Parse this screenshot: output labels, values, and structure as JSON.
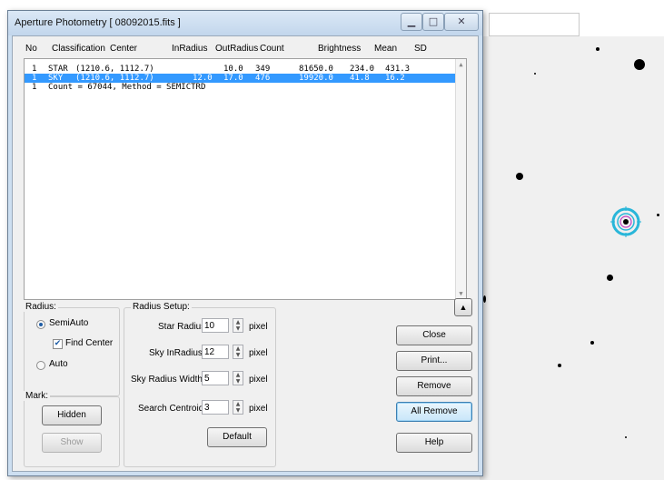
{
  "window": {
    "title": "Aperture Photometry [ 08092015.fits ]",
    "minimize_icon": "minimize-icon",
    "maximize_icon": "maximize-icon",
    "close_icon": "close-icon"
  },
  "table": {
    "columns": [
      "No",
      "Classification",
      "Center",
      "InRadius",
      "OutRadius",
      "Count",
      "Brightness",
      "Mean",
      "SD"
    ],
    "rows": [
      {
        "no": "1",
        "classification": "STAR",
        "center": "(1210.6, 1112.7)",
        "inradius": "",
        "outradius": "10.0",
        "count": "349",
        "brightness": "81650.0",
        "mean": "234.0",
        "sd": "431.3",
        "selected": false
      },
      {
        "no": "1",
        "classification": "SKY",
        "center": "(1210.6, 1112.7)",
        "inradius": "12.0",
        "outradius": "17.0",
        "count": "476",
        "brightness": "19920.0",
        "mean": "41.8",
        "sd": "16.2",
        "selected": true
      },
      {
        "no": "1",
        "summary": "Count = 67044, Method = SEMICTRD",
        "selected": false
      }
    ]
  },
  "radius_group": {
    "label": "Radius:",
    "semiauto_label": "SemiAuto",
    "semiauto_selected": true,
    "find_center_label": "Find Center",
    "find_center_checked": true,
    "auto_label": "Auto",
    "auto_selected": false
  },
  "mark_group": {
    "label": "Mark:",
    "hidden_label": "Hidden",
    "show_label": "Show"
  },
  "radius_setup": {
    "label": "Radius Setup:",
    "star_radius_label": "Star Radius:",
    "star_radius_value": "10",
    "sky_inradius_label": "Sky InRadius:",
    "sky_inradius_value": "12",
    "sky_width_label": "Sky Radius Width:",
    "sky_width_value": "5",
    "search_centroid_label": "Search Centroid:",
    "search_centroid_value": "3",
    "unit": "pixel",
    "default_label": "Default"
  },
  "buttons": {
    "collapse_icon": "triangle-up-icon",
    "close": "Close",
    "print": "Print...",
    "remove": "Remove",
    "all_remove": "All Remove",
    "help": "Help"
  },
  "colors": {
    "selection": "#3399ff",
    "marker": "#29b6d9",
    "marker_inner": "#c03cc0"
  }
}
